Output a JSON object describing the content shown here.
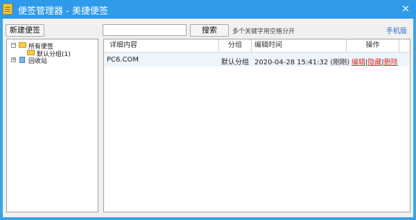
{
  "window": {
    "title": "便签管理器 - 美捷便签",
    "close_glyph": "×"
  },
  "toolbar": {
    "new_note_label": "新建便签",
    "search_value": "",
    "search_placeholder": "",
    "search_button_label": "搜索",
    "search_hint": "多个关键字用空格分开",
    "mobile_label": "手机版"
  },
  "tree": {
    "root_label": "所有便签",
    "root_expander": "−",
    "child_label": "默认分组(1)",
    "recycle_label": "回收站",
    "recycle_expander": "+"
  },
  "table": {
    "headers": [
      "详细内容",
      "分组",
      "编辑时间",
      "操作"
    ],
    "rows": [
      {
        "content": "PC6.COM",
        "group": "默认分组",
        "time": "2020-04-28 15:41:32 (刚刚)",
        "actions": [
          "编辑",
          "隐藏",
          "删除"
        ],
        "separator": "|"
      }
    ]
  },
  "colors": {
    "titlebar": "#2f9ae8",
    "window_border": "#3da3e6",
    "action_link": "#d93025",
    "mobile_link": "#2a6fcf"
  }
}
